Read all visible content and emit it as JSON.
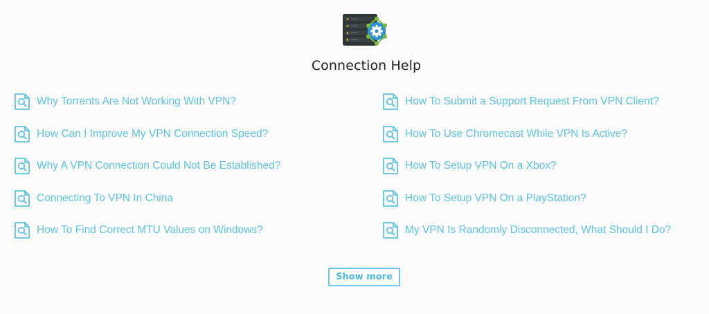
{
  "header": {
    "icon": "server-gear-icon",
    "title": "Connection Help"
  },
  "articles": {
    "left": [
      {
        "label": "Why Torrents Are Not Working With VPN?",
        "icon": "document-search-icon"
      },
      {
        "label": "How Can I Improve My VPN Connection Speed?",
        "icon": "document-search-icon"
      },
      {
        "label": "Why A VPN Connection Could Not Be Established?",
        "icon": "document-search-icon"
      },
      {
        "label": "Connecting To VPN In China",
        "icon": "document-search-icon"
      },
      {
        "label": "How To Find Correct MTU Values on Windows?",
        "icon": "document-search-icon"
      }
    ],
    "right": [
      {
        "label": "How To Submit a Support Request From VPN Client?",
        "icon": "document-search-icon"
      },
      {
        "label": "How To Use Chromecast While VPN Is Active?",
        "icon": "document-search-icon"
      },
      {
        "label": "How To Setup VPN On a Xbox?",
        "icon": "document-search-icon"
      },
      {
        "label": "How To Setup VPN On a PlayStation?",
        "icon": "document-search-icon"
      },
      {
        "label": "My VPN Is Randomly Disconnected, What Should I Do?",
        "icon": "document-search-icon"
      }
    ]
  },
  "actions": {
    "show_more_label": "Show more"
  },
  "colors": {
    "link": "#5cc3e6",
    "accent": "#4fb9df",
    "server_dark": "#2e3336",
    "gear_blue": "#2f8fd2",
    "node_green": "#7dbb3c",
    "title": "#222222",
    "background": "#fcfcfc"
  }
}
